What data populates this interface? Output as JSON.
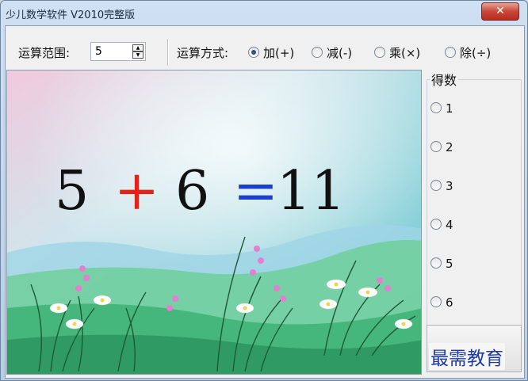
{
  "window": {
    "title": "少儿数学软件 V2010完整版",
    "close_glyph": "✕"
  },
  "toolbar": {
    "range_label": "运算范围:",
    "range_value": "5",
    "method_label": "运算方式:",
    "operations": [
      {
        "label": "加(+)",
        "selected": true
      },
      {
        "label": "减(-)",
        "selected": false
      },
      {
        "label": "乘(×)",
        "selected": false
      },
      {
        "label": "除(÷)",
        "selected": false
      }
    ]
  },
  "equation": {
    "a": "5",
    "op": "+",
    "b": "6",
    "eq": "=",
    "result": "11"
  },
  "score": {
    "title": "得数",
    "choices": [
      "1",
      "2",
      "3",
      "4",
      "5",
      "6"
    ]
  },
  "watermark": "最需教育",
  "colors": {
    "operator": "#e32219",
    "equals": "#1a3ecf",
    "watermark": "#1c3aa8"
  },
  "icons": {
    "spin_up": "spin-up-icon",
    "spin_down": "spin-down-icon",
    "close": "close-icon"
  }
}
